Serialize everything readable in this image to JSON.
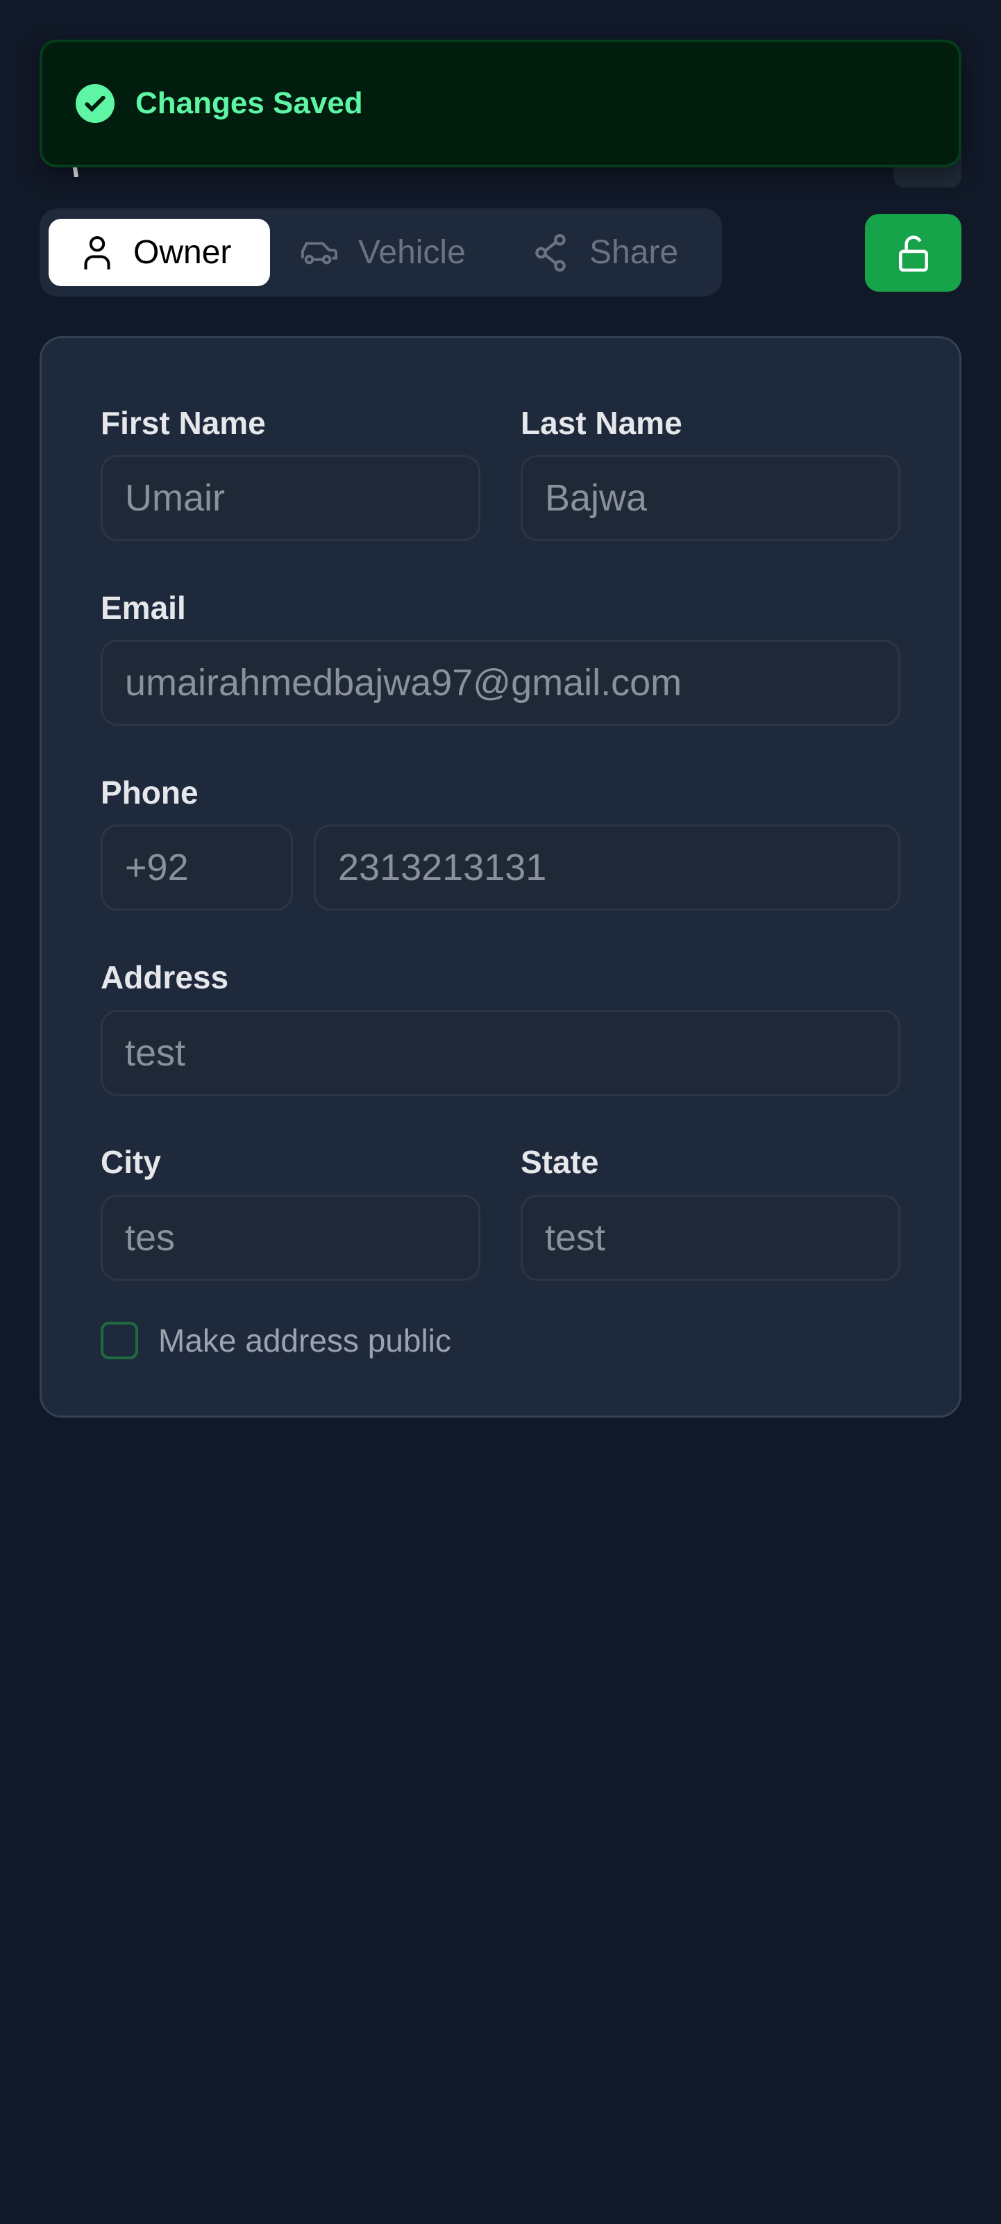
{
  "toast": {
    "message": "Changes Saved",
    "icon": "check-circle-icon"
  },
  "tabs": [
    {
      "label": "Owner",
      "icon": "user-icon",
      "active": true
    },
    {
      "label": "Vehicle",
      "icon": "car-icon"
    },
    {
      "label": "Share",
      "icon": "share-icon"
    }
  ],
  "lock_button": {
    "icon": "unlock-icon"
  },
  "form": {
    "first_name": {
      "label": "First Name",
      "value": "Umair"
    },
    "last_name": {
      "label": "Last Name",
      "value": "Bajwa"
    },
    "email": {
      "label": "Email",
      "value": "umairahmedbajwa97@gmail.com"
    },
    "phone": {
      "label": "Phone",
      "country_code": "+92",
      "number": "2313213131"
    },
    "address": {
      "label": "Address",
      "value": "test"
    },
    "city": {
      "label": "City",
      "value": "tes"
    },
    "state": {
      "label": "State",
      "value": "test"
    },
    "public_checkbox": {
      "label": "Make address public",
      "checked": false
    }
  },
  "colors": {
    "background": "#111827",
    "card": "#1e293b",
    "accent": "#16a34a",
    "toast_text": "#5ef5a4"
  }
}
